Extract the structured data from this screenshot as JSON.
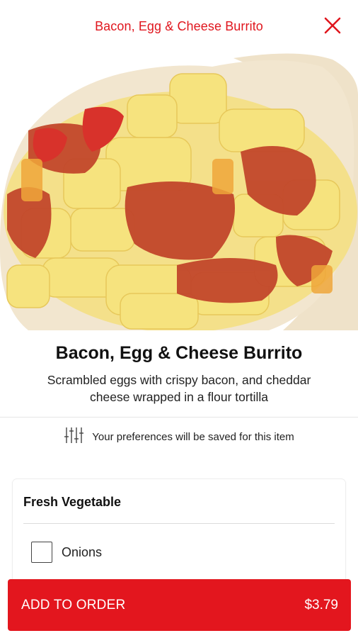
{
  "header": {
    "title": "Bacon, Egg & Cheese Burrito",
    "close_icon": "close-icon"
  },
  "hero": {
    "image_icon": "burrito-photo"
  },
  "item": {
    "title": "Bacon, Egg & Cheese Burrito",
    "description": "Scrambled eggs with crispy bacon, and cheddar cheese wrapped in a flour tortilla"
  },
  "preferences": {
    "icon": "sliders-icon",
    "text": "Your preferences will be saved for this item"
  },
  "customize": {
    "heading": "Fresh Vegetable",
    "options": [
      {
        "label": "Onions",
        "checked": false
      }
    ]
  },
  "footer": {
    "add_label": "ADD TO ORDER",
    "price": "$3.79"
  },
  "colors": {
    "accent": "#e3161e",
    "header_text": "#e0161e"
  }
}
